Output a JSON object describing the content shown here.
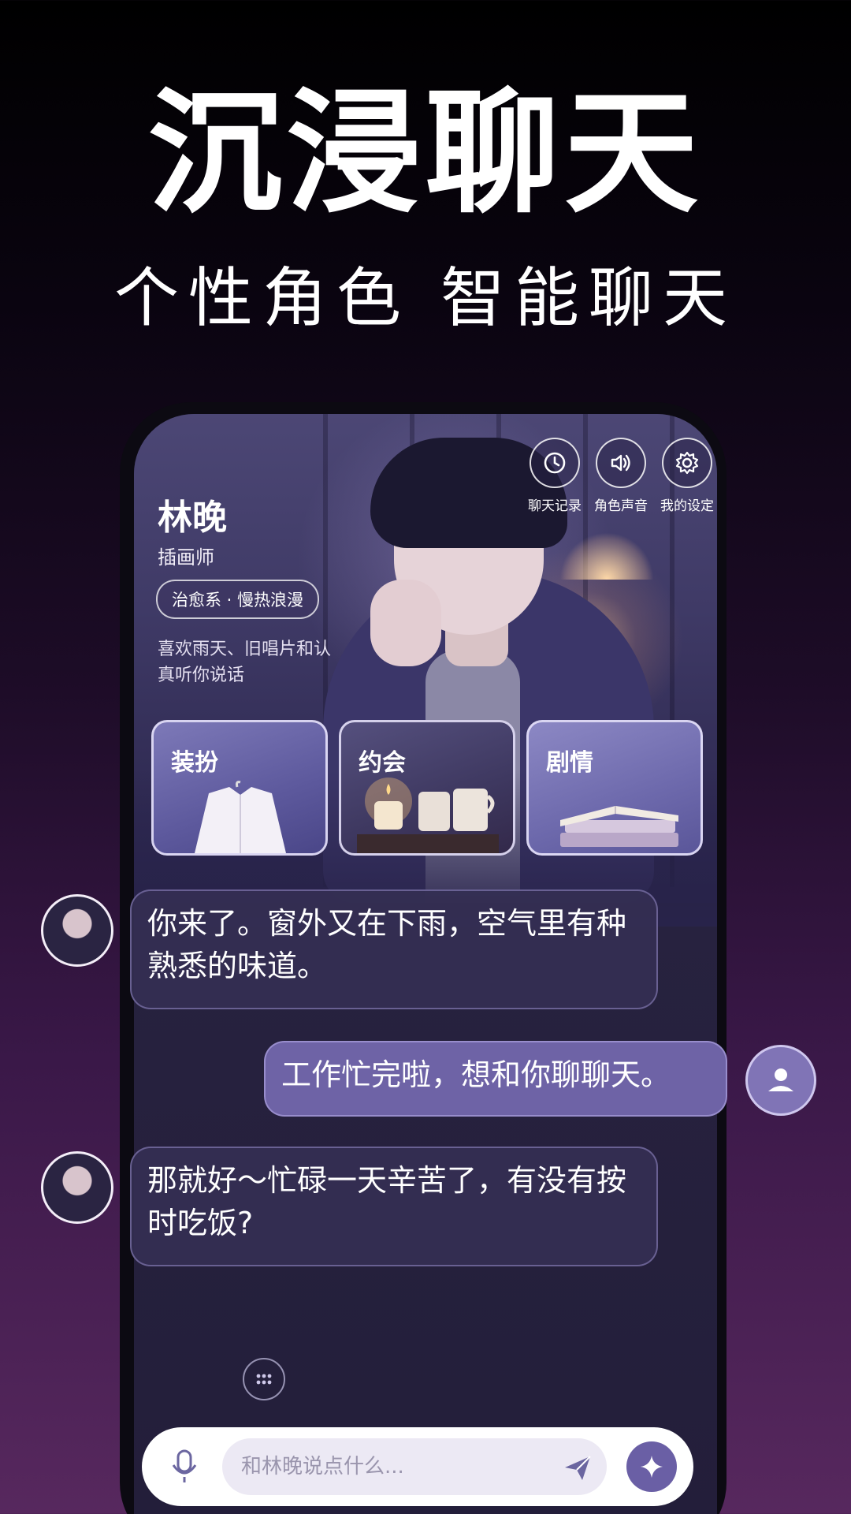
{
  "promo": {
    "headline": "沉浸聊天",
    "subline": "个性角色 智能聊天"
  },
  "profile": {
    "name": "林晚",
    "role": "插画师",
    "tag": "治愈系 · 慢热浪漫",
    "description": "喜欢雨天、旧唱片和认真听你说话"
  },
  "top_actions": [
    {
      "label": "聊天记录",
      "icon": "clock-icon"
    },
    {
      "label": "角色声音",
      "icon": "speaker-icon"
    },
    {
      "label": "我的设定",
      "icon": "gear-icon"
    }
  ],
  "cards": [
    {
      "title": "装扮",
      "icon": "shirt-image"
    },
    {
      "title": "约会",
      "icon": "candle-cups-image"
    },
    {
      "title": "剧情",
      "icon": "books-image"
    }
  ],
  "messages": [
    {
      "sender": "ai",
      "text": "你来了。窗外又在下雨，空气里有种熟悉的味道。"
    },
    {
      "sender": "user",
      "text": "工作忙完啦，想和你聊聊天。"
    },
    {
      "sender": "ai",
      "text": "那就好～忙碌一天辛苦了，有没有按时吃饭?"
    }
  ],
  "input": {
    "placeholder": "和林晚说点什么..."
  },
  "colors": {
    "accent": "#6e63a6",
    "bubble_ai": "#342e52",
    "background_bottom": "#57285e"
  }
}
